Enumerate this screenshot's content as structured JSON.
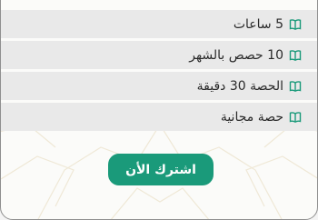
{
  "plan": {
    "features": [
      {
        "label": "5 ساعات",
        "icon": "open-book-icon"
      },
      {
        "label": "10 حصص بالشهر",
        "icon": "open-book-icon"
      },
      {
        "label": "الحصة 30 دقيقة",
        "icon": "open-book-icon"
      },
      {
        "label": "حصة مجانية",
        "icon": "open-book-icon"
      }
    ],
    "subscribe_label": "اشترك الأن"
  },
  "colors": {
    "accent": "#1a9a7a",
    "row_bg": "#e9e9e9",
    "card_bg": "#fbfbf9"
  }
}
